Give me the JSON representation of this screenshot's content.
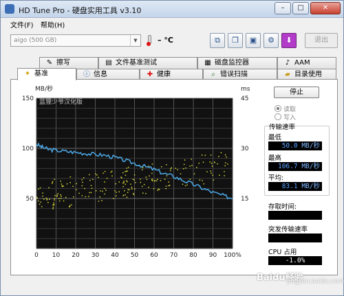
{
  "window": {
    "title": "HD Tune Pro - 硬盘实用工具 v3.10",
    "min_glyph": "–",
    "max_glyph": "□",
    "close_glyph": "✕"
  },
  "menu": [
    "文件(F)",
    "帮助(H)"
  ],
  "toolbar": {
    "drive": "aigo    (500 GB)",
    "temperature": "– °C",
    "exit_label": "退出"
  },
  "tabs_row1": [
    {
      "label": "擦写",
      "icon": "eraser-icon"
    },
    {
      "label": "文件基准测试",
      "icon": "file-benchmark-icon"
    },
    {
      "label": "磁盘监控器",
      "icon": "disk-monitor-icon"
    },
    {
      "label": "AAM",
      "icon": "speaker-icon"
    }
  ],
  "tabs_row2": [
    {
      "label": "基准",
      "icon": "lightbulb-icon",
      "active": true
    },
    {
      "label": "信息",
      "icon": "info-icon"
    },
    {
      "label": "健康",
      "icon": "red-cross-icon"
    },
    {
      "label": "错误扫描",
      "icon": "magnifier-icon"
    },
    {
      "label": "目录使用",
      "icon": "folder-icon"
    }
  ],
  "chart": {
    "watermark": "蓝狸少爷汉化版"
  },
  "chart_data": {
    "type": "line",
    "y_left_label": "MB/秒",
    "y_right_label": "ms",
    "y_left_ticks": [
      50,
      100,
      150
    ],
    "y_right_ticks": [
      15,
      30,
      45
    ],
    "y_left_range": [
      0,
      150
    ],
    "y_right_range": [
      0,
      45
    ],
    "x_ticks": [
      "0",
      "10",
      "20",
      "30",
      "40",
      "50",
      "60",
      "70",
      "80",
      "90",
      "100%"
    ],
    "x_range": [
      0,
      100
    ],
    "series": [
      {
        "kind": "transfer rate (line)",
        "color": "#4aa3df",
        "x": [
          0,
          3,
          6,
          10,
          15,
          20,
          25,
          30,
          35,
          40,
          45,
          50,
          55,
          60,
          65,
          70,
          75,
          80,
          85,
          90,
          95,
          100
        ],
        "y": [
          104,
          101,
          99,
          98,
          97,
          96,
          95,
          94,
          93,
          91,
          88,
          85,
          82,
          79,
          75,
          72,
          68,
          64,
          60,
          56,
          53,
          50
        ]
      },
      {
        "kind": "access time (scatter)",
        "color": "#d8d83a",
        "note": "yellow points between ~45 and ~90 MB/s scale"
      }
    ],
    "grid": true
  },
  "side": {
    "stop_label": "停止",
    "read_label": "读取",
    "write_label": "写入",
    "group_label": "传输速率",
    "min_label": "最低",
    "min_value": "50.0",
    "max_label": "最高",
    "max_value": "106.7",
    "avg_label": "平均:",
    "avg_value": "83.1",
    "unit": "MB/秒",
    "access_label": "存取时间:",
    "burst_label": "突发传输速率",
    "cpu_label": "CPU 占用",
    "cpu_value": "-1.0%"
  },
  "watermark": {
    "line1": "Baidu经验",
    "line2": "jingyan.baidu.com"
  }
}
